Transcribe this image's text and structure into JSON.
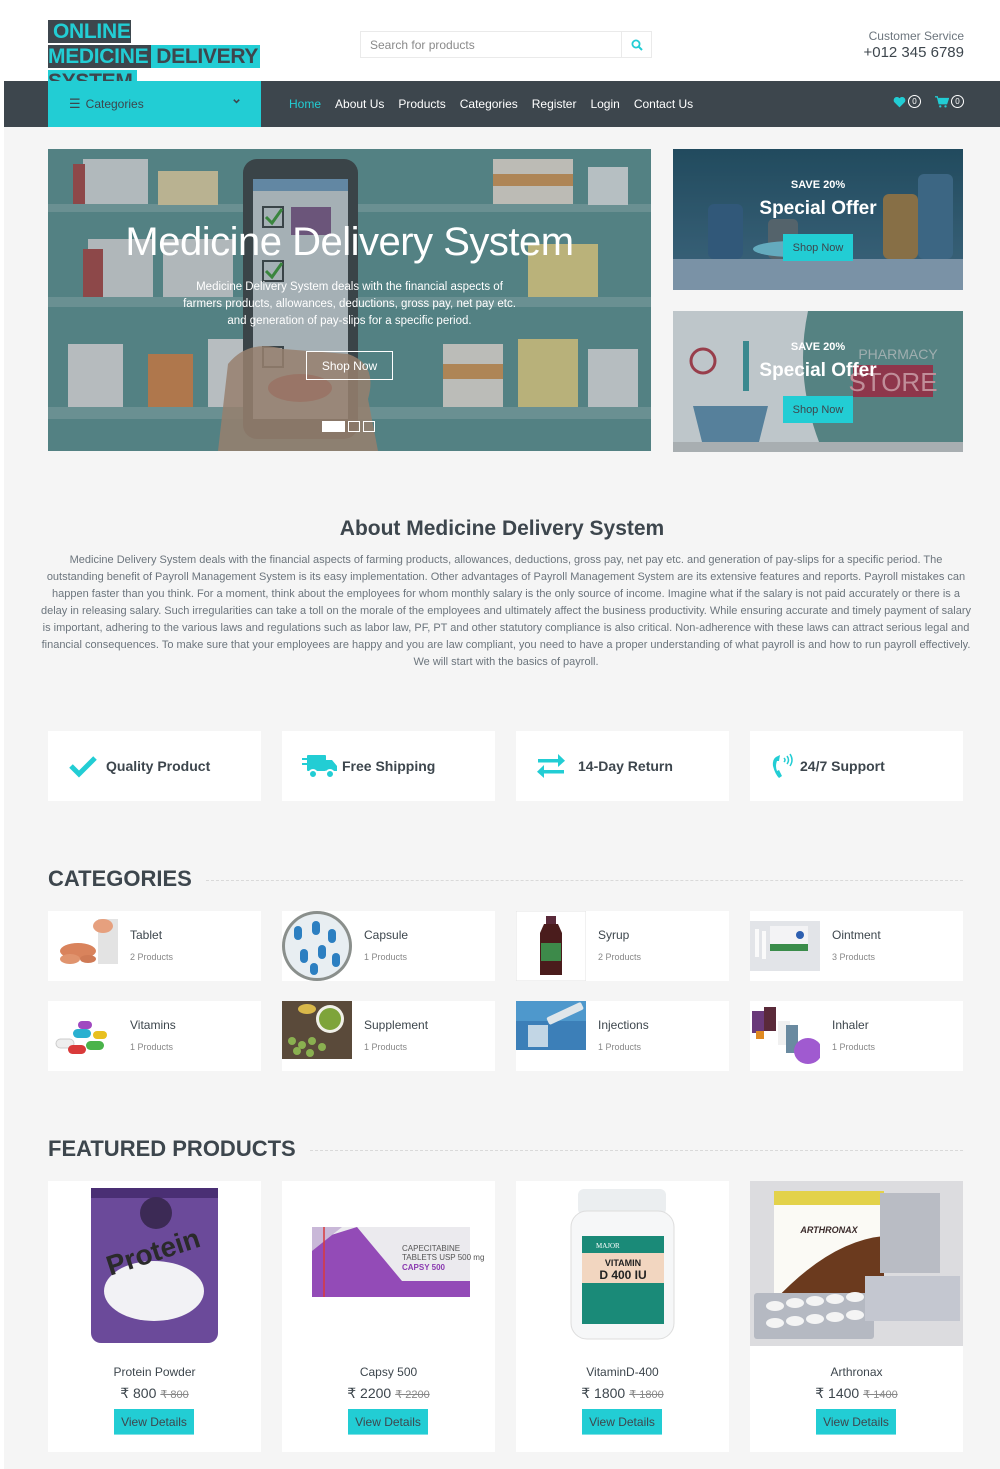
{
  "brand": {
    "logo_line1": "ONLINE MEDICINE",
    "logo_line1b": "DELIVERY",
    "logo_line2": "SYSTEM"
  },
  "search": {
    "placeholder": "Search for products",
    "icon": "search-icon"
  },
  "customer_service": {
    "label": "Customer Service",
    "phone": "+012 345 6789"
  },
  "navbar": {
    "categories_label": "Categories",
    "links": [
      {
        "label": "Home",
        "active": true
      },
      {
        "label": "About Us"
      },
      {
        "label": "Products"
      },
      {
        "label": "Categories"
      },
      {
        "label": "Register"
      },
      {
        "label": "Login"
      },
      {
        "label": "Contact Us"
      }
    ],
    "wishlist_count": "0",
    "cart_count": "0"
  },
  "hero": {
    "title": "Medicine Delivery System",
    "text": "Medicine Delivery System deals with the financial aspects of farmers products, allowances, deductions, gross pay, net pay etc. and generation of pay-slips for a specific period.",
    "button": "Shop Now",
    "slides": 3,
    "active_slide": 1
  },
  "offers": [
    {
      "save": "SAVE 20%",
      "title": "Special Offer",
      "button": "Shop Now"
    },
    {
      "save": "SAVE 20%",
      "title": "Special Offer",
      "button": "Shop Now"
    }
  ],
  "about": {
    "title": "About Medicine Delivery System",
    "text": "Medicine Delivery System deals with the financial aspects of farming products, allowances, deductions, gross pay, net pay etc. and generation of pay-slips for a specific period. The outstanding benefit of Payroll Management System is its easy implementation. Other advantages of Payroll Management System are its extensive features and reports. Payroll mistakes can happen faster than you think. For a moment, think about the employees for whom monthly salary is the only source of income. Imagine what if the salary is not paid accurately or there is a delay in releasing salary. Such irregularities can take a toll on the morale of the employees and ultimately affect the business productivity. While ensuring accurate and timely payment of salary is important, adhering to the various laws and regulations such as labor law, PF, PT and other statutory compliance is also critical. Non-adherence with these laws can attract serious legal and financial consequences. To make sure that your employees are happy and you are law compliant, you need to have a proper understanding of what payroll is and how to run payroll effectively. We will start with the basics of payroll."
  },
  "features": [
    {
      "label": "Quality Product",
      "icon": "check-icon"
    },
    {
      "label": "Free Shipping",
      "icon": "truck-icon"
    },
    {
      "label": "14-Day Return",
      "icon": "exchange-icon"
    },
    {
      "label": "24/7 Support",
      "icon": "phone-icon"
    }
  ],
  "categories": {
    "title": "CATEGORIES",
    "items": [
      {
        "name": "Tablet",
        "count": "2 Products"
      },
      {
        "name": "Capsule",
        "count": "1 Products"
      },
      {
        "name": "Syrup",
        "count": "2 Products"
      },
      {
        "name": "Ointment",
        "count": "3 Products"
      },
      {
        "name": "Vitamins",
        "count": "1 Products"
      },
      {
        "name": "Supplement",
        "count": "1 Products"
      },
      {
        "name": "Injections",
        "count": "1 Products"
      },
      {
        "name": "Inhaler",
        "count": "1 Products"
      }
    ]
  },
  "featured": {
    "title": "FEATURED PRODUCTS",
    "items": [
      {
        "name": "Protein Powder",
        "price": "₹ 800",
        "old_price": "₹ 800",
        "button": "View Details"
      },
      {
        "name": "Capsy 500",
        "price": "₹ 2200",
        "old_price": "₹ 2200",
        "button": "View Details"
      },
      {
        "name": "VitaminD-400",
        "price": "₹ 1800",
        "old_price": "₹ 1800",
        "button": "View Details"
      },
      {
        "name": "Arthronax",
        "price": "₹ 1400",
        "old_price": "₹ 1400",
        "button": "View Details"
      }
    ]
  },
  "colors": {
    "accent": "#22cdd4",
    "dark": "#3d464d",
    "background": "#f5f5f5"
  }
}
